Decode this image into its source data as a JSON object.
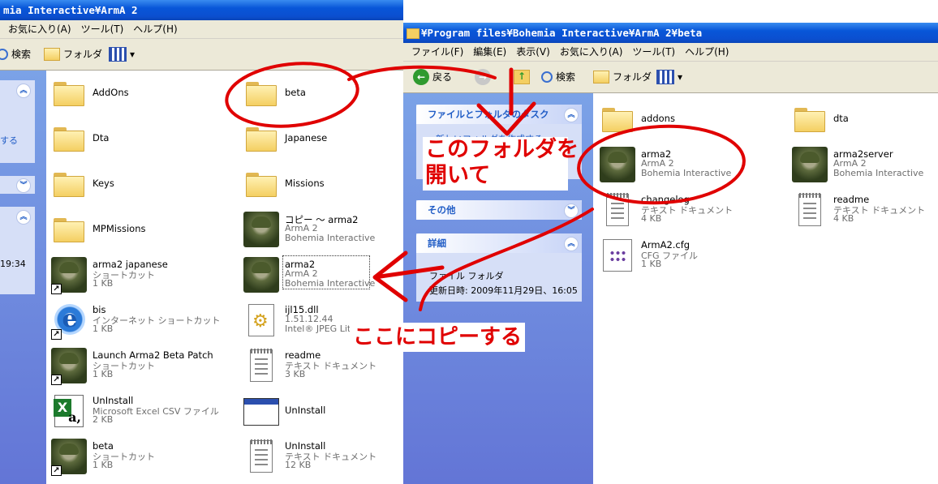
{
  "left_window": {
    "title": "mia Interactive¥ArmA 2",
    "menu": [
      "お気に入り(A)",
      "ツール(T)",
      "ヘルプ(H)"
    ],
    "toolbar": {
      "search": "検索",
      "folders": "フォルダ"
    },
    "taskpane_text": "する",
    "taskpane_time": "19:34",
    "items": [
      {
        "name": "AddOns",
        "type": "folder"
      },
      {
        "name": "beta",
        "type": "folder"
      },
      {
        "name": "Dta",
        "type": "folder"
      },
      {
        "name": "Japanese",
        "type": "folder"
      },
      {
        "name": "Keys",
        "type": "folder"
      },
      {
        "name": "Missions",
        "type": "folder"
      },
      {
        "name": "MPMissions",
        "type": "folder"
      },
      {
        "name": "コピー ～ arma2",
        "l2": "ArmA 2",
        "l3": "Bohemia Interactive",
        "type": "soldier"
      },
      {
        "name": "arma2 japanese",
        "l2": "ショートカット",
        "l3": "1 KB",
        "type": "soldier-short"
      },
      {
        "name": "arma2",
        "l2": "ArmA 2",
        "l3": "Bohemia Interactive",
        "type": "soldier"
      },
      {
        "name": "bis",
        "l2": "インターネット ショートカット",
        "l3": "1 KB",
        "type": "ie"
      },
      {
        "name": "ijl15.dll",
        "l2": "1.51.12.44",
        "l3": "Intel® JPEG Lit",
        "type": "dll"
      },
      {
        "name": "Launch Arma2 Beta Patch",
        "l2": "ショートカット",
        "l3": "1 KB",
        "type": "soldier-short"
      },
      {
        "name": "readme",
        "l2": "テキスト ドキュメント",
        "l3": "3 KB",
        "type": "txt"
      },
      {
        "name": "UnInstall",
        "l2": "Microsoft Excel CSV ファイル",
        "l3": "2 KB",
        "type": "xls"
      },
      {
        "name": "UnInstall",
        "type": "win"
      },
      {
        "name": "beta",
        "l2": "ショートカット",
        "l3": "1 KB",
        "type": "soldier-short"
      },
      {
        "name": "UnInstall",
        "l2": "テキスト ドキュメント",
        "l3": "12 KB",
        "type": "txt"
      }
    ]
  },
  "right_window": {
    "title": "¥Program files¥Bohemia Interactive¥ArmA 2¥beta",
    "menu": [
      "ファイル(F)",
      "編集(E)",
      "表示(V)",
      "お気に入り(A)",
      "ツール(T)",
      "ヘルプ(H)"
    ],
    "toolbar": {
      "back": "戻る",
      "search": "検索",
      "folders": "フォルダ"
    },
    "panels": {
      "tasks_title": "ファイルとフォルダのタスク",
      "tasks_item": "新しいフォルダを作成する",
      "other_title": "その他",
      "details_title": "詳細",
      "details_type": "ファイル フォルダ",
      "details_date": "更新日時: 2009年11月29日、16:05"
    },
    "items": [
      {
        "name": "addons",
        "type": "folder"
      },
      {
        "name": "dta",
        "type": "folder"
      },
      {
        "name": "arma2",
        "l2": "ArmA 2",
        "l3": "Bohemia Interactive",
        "type": "soldier"
      },
      {
        "name": "arma2server",
        "l2": "ArmA 2",
        "l3": "Bohemia Interactive",
        "type": "soldier"
      },
      {
        "name": "changelog",
        "l2": "テキスト ドキュメント",
        "l3": "4 KB",
        "type": "txt"
      },
      {
        "name": "readme",
        "l2": "テキスト ドキュメント",
        "l3": "4 KB",
        "type": "txt"
      },
      {
        "name": "ArmA2.cfg",
        "l2": "CFG ファイル",
        "l3": "1 KB",
        "type": "cfg"
      }
    ]
  },
  "annotations": {
    "open_folder_line1": "このフォルダを",
    "open_folder_line2": "開いて",
    "copy_here": "ここにコピーする",
    "color": "#e00000"
  }
}
